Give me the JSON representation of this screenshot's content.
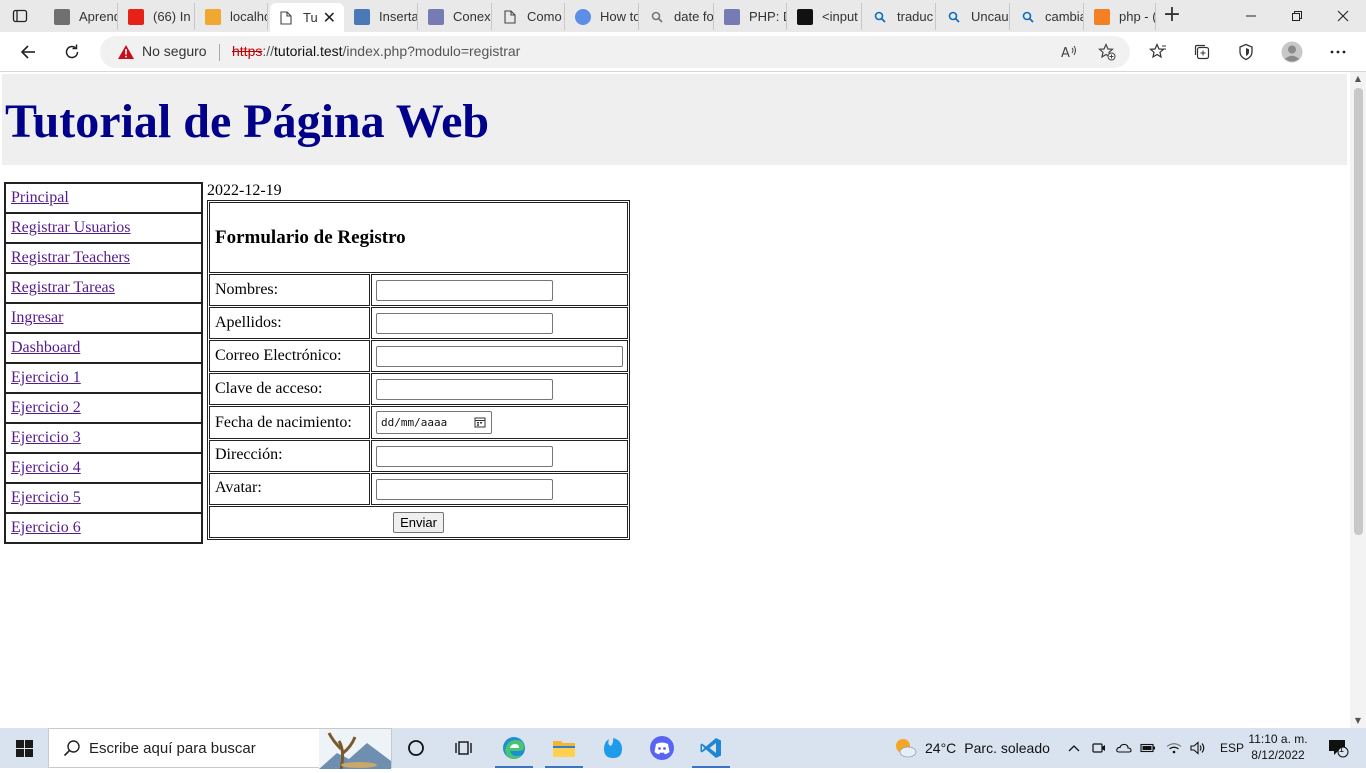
{
  "browser": {
    "tabs": [
      {
        "title": "Aprend",
        "favicon": "bookmark-icon",
        "color": "#707070"
      },
      {
        "title": "(66) In",
        "favicon": "youtube-icon",
        "color": "#e62117"
      },
      {
        "title": "localho",
        "favicon": "xampp-icon",
        "color": "#f0a830"
      },
      {
        "title": "Tu",
        "favicon": "document-icon",
        "color": "#555555",
        "active": true
      },
      {
        "title": "Inserta",
        "favicon": "bp-icon",
        "color": "#4a78b8"
      },
      {
        "title": "Conexi",
        "favicon": "php-icon",
        "color": "#777bb3"
      },
      {
        "title": "Como",
        "favicon": "document-icon",
        "color": "#555555"
      },
      {
        "title": "How to",
        "favicon": "globe-icon",
        "color": "#5c8ee8"
      },
      {
        "title": "date fo",
        "favicon": "search-icon",
        "color": "#777777"
      },
      {
        "title": "PHP: D",
        "favicon": "php-icon",
        "color": "#777bb3"
      },
      {
        "title": "<input",
        "favicon": "mdn-icon",
        "color": "#111111"
      },
      {
        "title": "traduc",
        "favicon": "search-icon",
        "color": "#0f6cbd"
      },
      {
        "title": "Uncau",
        "favicon": "search-icon",
        "color": "#0f6cbd"
      },
      {
        "title": "cambia",
        "favicon": "search-icon",
        "color": "#0f6cbd"
      },
      {
        "title": "php - (",
        "favicon": "stackoverflow-icon",
        "color": "#f48024"
      }
    ],
    "security_label": "No seguro",
    "url_scheme": "https",
    "url_sep": "://",
    "url_host": "tutorial.test",
    "url_path": "/index.php?modulo=registrar"
  },
  "page": {
    "title": "Tutorial de Página Web",
    "date": "2022-12-19",
    "menu": [
      "Principal",
      "Registrar Usuarios",
      "Registrar Teachers",
      "Registrar Tareas",
      "Ingresar",
      "Dashboard",
      "Ejercicio 1",
      "Ejercicio 2",
      "Ejercicio 3",
      "Ejercicio 4",
      "Ejercicio 5",
      "Ejercicio 6"
    ],
    "form": {
      "heading": "Formulario de Registro",
      "labels": {
        "nombres": "Nombres:",
        "apellidos": "Apellidos:",
        "correo": "Correo Electrónico:",
        "clave": "Clave de acceso:",
        "fecha": "Fecha de nacimiento:",
        "direccion": "Dirección:",
        "avatar": "Avatar:"
      },
      "date_placeholder": "dd/mm/aaaa",
      "submit": "Enviar"
    },
    "link_color": "#551a8b",
    "title_color": "#00008b"
  },
  "taskbar": {
    "search_placeholder": "Escribe aquí para buscar",
    "weather_temp": "24°C",
    "weather_text": "Parc. soleado",
    "language": "ESP",
    "time": "11:10 a. m.",
    "date": "8/12/2022",
    "notification_count": "1"
  }
}
